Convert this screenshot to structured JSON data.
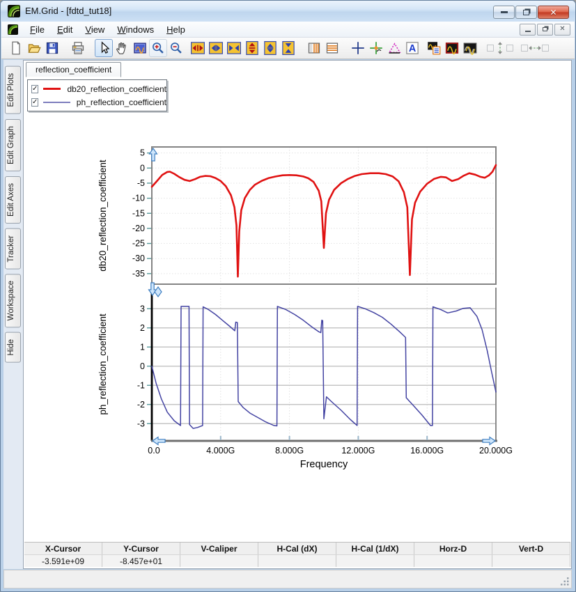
{
  "window": {
    "title": "EM.Grid - [fdtd_tut18]"
  },
  "menu": {
    "items": [
      "File",
      "Edit",
      "View",
      "Windows",
      "Help"
    ]
  },
  "toolbar": {
    "icons": [
      "new-document",
      "open-file",
      "save",
      "print",
      "select-arrow",
      "pan-hand",
      "zoom-box",
      "zoom-in",
      "zoom-out",
      "expand-x",
      "fit-x",
      "compress-x",
      "expand-y",
      "fit-y",
      "compress-y",
      "vertical-markers",
      "horizontal-markers",
      "crosshair",
      "tracker-cross",
      "caliper-triangle",
      "text-annotation",
      "plot-with-legend",
      "single-graph",
      "overlay-graphs",
      "vertical-spacing",
      "horizontal-spacing"
    ]
  },
  "sidebar": {
    "tabs": [
      "Edit Plots",
      "Edit Graph",
      "Edit Axes",
      "Tracker",
      "Workspace",
      "Hide"
    ]
  },
  "plot_tab": {
    "label": "reflection_coefficient"
  },
  "legend": {
    "items": [
      {
        "label": "db20_reflection_coefficient",
        "color": "#e01212",
        "checked": true
      },
      {
        "label": "ph_reflection_coefficient",
        "color": "#7d7dbd",
        "checked": true
      }
    ]
  },
  "chart_data": [
    {
      "type": "line",
      "title": "",
      "ylabel": "db20_reflection_coefficient",
      "xlabel": "",
      "xlim": [
        0,
        20
      ],
      "ylim": [
        -38.5,
        7
      ],
      "yticks": [
        5,
        0,
        -5,
        -10,
        -15,
        -20,
        -25,
        -30,
        -35
      ],
      "grid": true,
      "legend_position": "top-left-floating",
      "series": [
        {
          "name": "db20_reflection_coefficient",
          "color": "#e01212",
          "x": [
            0,
            0.3,
            0.6,
            0.9,
            1.05,
            1.3,
            1.6,
            1.9,
            2.2,
            2.5,
            2.8,
            3.1,
            3.4,
            3.7,
            4.0,
            4.3,
            4.6,
            4.8,
            4.92,
            5.0,
            5.08,
            5.2,
            5.4,
            5.7,
            6.0,
            6.4,
            6.8,
            7.2,
            7.6,
            8.0,
            8.4,
            8.8,
            9.1,
            9.4,
            9.7,
            9.85,
            10.0,
            10.12,
            10.3,
            10.6,
            11.0,
            11.4,
            11.8,
            12.2,
            12.7,
            13.2,
            13.6,
            14.0,
            14.35,
            14.65,
            14.85,
            15.0,
            15.12,
            15.3,
            15.6,
            16.0,
            16.4,
            16.8,
            17.1,
            17.45,
            17.8,
            18.1,
            18.45,
            18.8,
            19.1,
            19.35,
            19.6,
            19.8,
            20.0
          ],
          "y": [
            -6.2,
            -4.3,
            -2.3,
            -1.3,
            -1.2,
            -1.9,
            -3.0,
            -3.9,
            -4.3,
            -3.7,
            -2.9,
            -2.6,
            -2.7,
            -3.3,
            -4.3,
            -6.0,
            -9.0,
            -13,
            -19,
            -36,
            -21,
            -14,
            -10,
            -7.2,
            -5.5,
            -4.2,
            -3.3,
            -2.8,
            -2.4,
            -2.3,
            -2.4,
            -2.8,
            -3.4,
            -4.6,
            -7.5,
            -11,
            -26.5,
            -15,
            -10.5,
            -7.2,
            -5.0,
            -3.6,
            -2.6,
            -2.0,
            -1.7,
            -1.7,
            -2.0,
            -2.8,
            -4.4,
            -8.0,
            -13,
            -35.5,
            -17,
            -11.5,
            -7.8,
            -5.2,
            -3.6,
            -2.9,
            -3.1,
            -4.3,
            -3.7,
            -2.6,
            -1.7,
            -2.2,
            -2.9,
            -3.2,
            -2.4,
            -1.2,
            1.0
          ]
        }
      ]
    },
    {
      "type": "line",
      "title": "",
      "ylabel": "ph_reflection_coefficient",
      "xlabel": "Frequency",
      "xlim": [
        0,
        20
      ],
      "ylim": [
        -3.9,
        4.1
      ],
      "yticks": [
        3,
        2,
        1,
        0,
        -1,
        -2,
        -3
      ],
      "xticks": [
        0,
        4,
        8,
        12,
        16,
        20
      ],
      "xtick_labels": [
        "0.0",
        "4.000G",
        "8.000G",
        "12.000G",
        "16.000G",
        "20.000G"
      ],
      "grid": true,
      "series": [
        {
          "name": "ph_reflection_coefficient",
          "color": "#4343a2",
          "x": [
            0,
            0.25,
            0.55,
            0.9,
            1.3,
            1.67,
            1.7,
            2.16,
            2.19,
            2.4,
            2.65,
            2.95,
            2.98,
            3.3,
            3.7,
            4.1,
            4.5,
            4.82,
            4.88,
            4.97,
            5.02,
            5.3,
            5.7,
            6.1,
            6.6,
            7.1,
            7.27,
            7.3,
            7.8,
            8.3,
            8.8,
            9.3,
            9.7,
            9.82,
            9.88,
            9.93,
            10.0,
            10.15,
            10.5,
            11.0,
            11.5,
            11.93,
            11.96,
            12.4,
            12.9,
            13.4,
            13.9,
            14.4,
            14.75,
            14.79,
            15.2,
            15.7,
            16.2,
            16.31,
            16.34,
            16.8,
            17.2,
            17.7,
            18.1,
            18.5,
            18.9,
            19.2,
            19.5,
            19.75,
            20.0
          ],
          "y": [
            0,
            -0.9,
            -1.7,
            -2.4,
            -2.85,
            -3.1,
            3.12,
            3.12,
            -3.05,
            -3.25,
            -3.2,
            -3.1,
            3.1,
            2.95,
            2.7,
            2.4,
            2.1,
            1.85,
            2.3,
            2.28,
            -1.85,
            -2.15,
            -2.45,
            -2.65,
            -2.9,
            -3.1,
            -3.12,
            3.12,
            2.95,
            2.7,
            2.4,
            2.05,
            1.8,
            1.75,
            2.4,
            2.38,
            -2.75,
            -1.6,
            -1.9,
            -2.3,
            -2.75,
            -3.1,
            3.12,
            3.0,
            2.8,
            2.55,
            2.2,
            1.8,
            1.5,
            -1.65,
            -2.05,
            -2.55,
            -3.1,
            -3.1,
            3.1,
            2.95,
            2.78,
            2.88,
            3.02,
            3.05,
            2.6,
            1.9,
            0.8,
            -0.3,
            -1.35
          ]
        }
      ]
    }
  ],
  "status_table": {
    "headers": [
      "X-Cursor",
      "Y-Cursor",
      "V-Caliper",
      "H-Cal (dX)",
      "H-Cal (1/dX)",
      "Horz-D",
      "Vert-D"
    ],
    "values": [
      "-3.591e+09",
      "-8.457e+01",
      "",
      "",
      "",
      "",
      ""
    ]
  },
  "colors": {
    "curve_db20": "#e01212",
    "curve_ph": "#4343a2",
    "axis_frame": "#838383",
    "axis_black": "#000000",
    "grid_solid": "#c6c6c6",
    "grid_dotted": "#e0e0e0",
    "tick_mark": "#55989a",
    "scroll_arrow_fill": "#cfe6fb",
    "scroll_arrow_stroke": "#3f7fc1",
    "titlebar_blue": "#c5daf0"
  }
}
